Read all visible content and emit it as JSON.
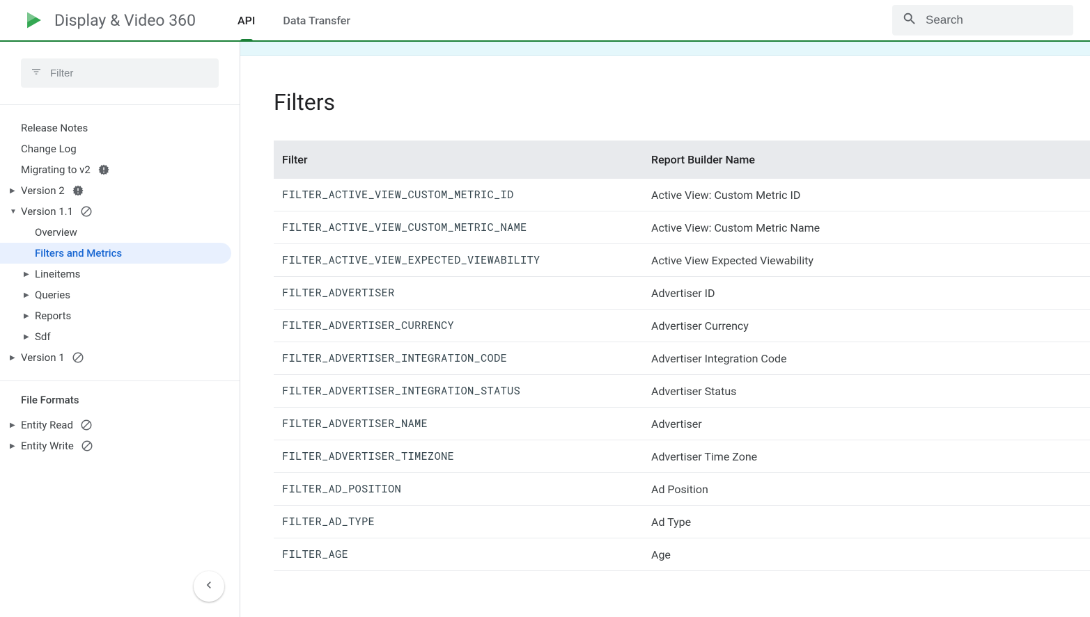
{
  "header": {
    "product_title": "Display & Video 360",
    "tabs": [
      {
        "label": "API",
        "active": true
      },
      {
        "label": "Data Transfer",
        "active": false
      }
    ],
    "search_placeholder": "Search"
  },
  "sidebar": {
    "filter_placeholder": "Filter",
    "items_top": [
      {
        "label": "Release Notes",
        "level": 1,
        "caret": "",
        "icon": ""
      },
      {
        "label": "Change Log",
        "level": 1,
        "caret": "",
        "icon": ""
      },
      {
        "label": "Migrating to v2",
        "level": 1,
        "caret": "",
        "icon": "alert"
      },
      {
        "label": "Version 2",
        "level": 1,
        "caret": "right",
        "icon": "alert"
      },
      {
        "label": "Version 1.1",
        "level": 1,
        "caret": "down",
        "icon": "deprecated"
      },
      {
        "label": "Overview",
        "level": 2,
        "caret": "",
        "icon": ""
      },
      {
        "label": "Filters and Metrics",
        "level": 2,
        "caret": "",
        "icon": "",
        "selected": true
      },
      {
        "label": "Lineitems",
        "level": 2,
        "caret": "right",
        "icon": ""
      },
      {
        "label": "Queries",
        "level": 2,
        "caret": "right",
        "icon": ""
      },
      {
        "label": "Reports",
        "level": 2,
        "caret": "right",
        "icon": ""
      },
      {
        "label": "Sdf",
        "level": 2,
        "caret": "right",
        "icon": ""
      },
      {
        "label": "Version 1",
        "level": 1,
        "caret": "right",
        "icon": "deprecated"
      }
    ],
    "section_title": "File Formats",
    "items_bottom": [
      {
        "label": "Entity Read",
        "level": 1,
        "caret": "right",
        "icon": "deprecated"
      },
      {
        "label": "Entity Write",
        "level": 1,
        "caret": "right",
        "icon": "deprecated"
      }
    ]
  },
  "main": {
    "heading": "Filters",
    "table": {
      "headers": {
        "col1": "Filter",
        "col2": "Report Builder Name"
      },
      "rows": [
        {
          "code": "FILTER_ACTIVE_VIEW_CUSTOM_METRIC_ID",
          "name": "Active View: Custom Metric ID"
        },
        {
          "code": "FILTER_ACTIVE_VIEW_CUSTOM_METRIC_NAME",
          "name": "Active View: Custom Metric Name"
        },
        {
          "code": "FILTER_ACTIVE_VIEW_EXPECTED_VIEWABILITY",
          "name": "Active View Expected Viewability"
        },
        {
          "code": "FILTER_ADVERTISER",
          "name": "Advertiser ID"
        },
        {
          "code": "FILTER_ADVERTISER_CURRENCY",
          "name": "Advertiser Currency"
        },
        {
          "code": "FILTER_ADVERTISER_INTEGRATION_CODE",
          "name": "Advertiser Integration Code"
        },
        {
          "code": "FILTER_ADVERTISER_INTEGRATION_STATUS",
          "name": "Advertiser Status"
        },
        {
          "code": "FILTER_ADVERTISER_NAME",
          "name": "Advertiser"
        },
        {
          "code": "FILTER_ADVERTISER_TIMEZONE",
          "name": "Advertiser Time Zone"
        },
        {
          "code": "FILTER_AD_POSITION",
          "name": "Ad Position"
        },
        {
          "code": "FILTER_AD_TYPE",
          "name": "Ad Type"
        },
        {
          "code": "FILTER_AGE",
          "name": "Age"
        }
      ]
    }
  }
}
